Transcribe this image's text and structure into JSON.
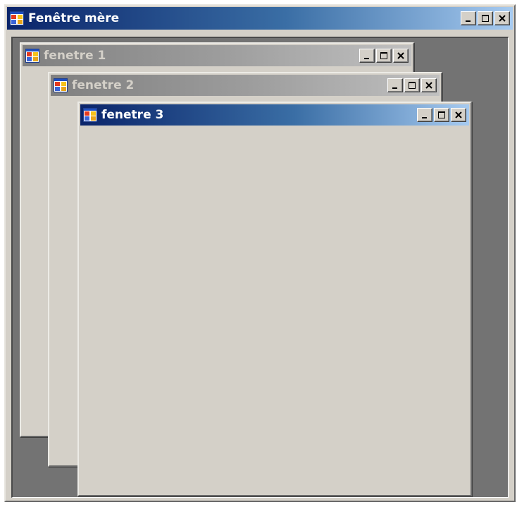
{
  "parent_window": {
    "title": "Fenêtre mère",
    "icon": "app-window-icon",
    "state": "active"
  },
  "child_windows": [
    {
      "title": "fenetre 1",
      "icon": "app-window-icon",
      "state": "inactive"
    },
    {
      "title": "fenetre 2",
      "icon": "app-window-icon",
      "state": "inactive"
    },
    {
      "title": "fenetre 3",
      "icon": "app-window-icon",
      "state": "active"
    }
  ],
  "controls": [
    "minimize-icon",
    "maximize-icon",
    "close-icon"
  ],
  "colors": {
    "active_title_start": "#0a246a",
    "active_title_end": "#a6caf0",
    "inactive_title_start": "#808080",
    "inactive_title_end": "#c0c0c0",
    "window_face": "#d4d0c8",
    "mdi_background": "#737373"
  }
}
